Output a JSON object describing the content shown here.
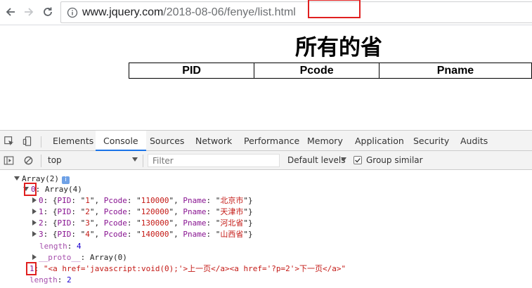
{
  "browser": {
    "url_host": "www.jquery.com",
    "url_path": "/2018-08-06/fenye/",
    "url_file": "list.html"
  },
  "page": {
    "title": "所有的省",
    "table_headers": [
      "PID",
      "Pcode",
      "Pname"
    ]
  },
  "devtools": {
    "tabs": [
      "Elements",
      "Console",
      "Sources",
      "Network",
      "Performance",
      "Memory",
      "Application",
      "Security",
      "Audits"
    ],
    "active_tab": "Console",
    "toolbar": {
      "context": "top",
      "filter_placeholder": "Filter",
      "levels": "Default levels",
      "group_similar": "Group similar",
      "group_similar_checked": true
    },
    "console": {
      "array_header": "Array(2)",
      "info_badge": "i",
      "item0_key": "0",
      "item0_value": "Array(4)",
      "rows": [
        {
          "idx": "0",
          "pid": "1",
          "pcode": "110000",
          "pname": "北京市"
        },
        {
          "idx": "1",
          "pid": "2",
          "pcode": "120000",
          "pname": "天津市"
        },
        {
          "idx": "2",
          "pid": "3",
          "pcode": "130000",
          "pname": "河北省"
        },
        {
          "idx": "3",
          "pid": "4",
          "pcode": "140000",
          "pname": "山西省"
        }
      ],
      "inner_length_key": "length",
      "inner_length_value": "4",
      "proto_key": "__proto__",
      "proto_value": "Array(0)",
      "item1_key": "1",
      "item1_value": "\"<a href='javascript:void(0);'>上一页</a><a href='?p=2'>下一页</a>\"",
      "outer_length_key": "length",
      "outer_length_value": "2"
    }
  }
}
